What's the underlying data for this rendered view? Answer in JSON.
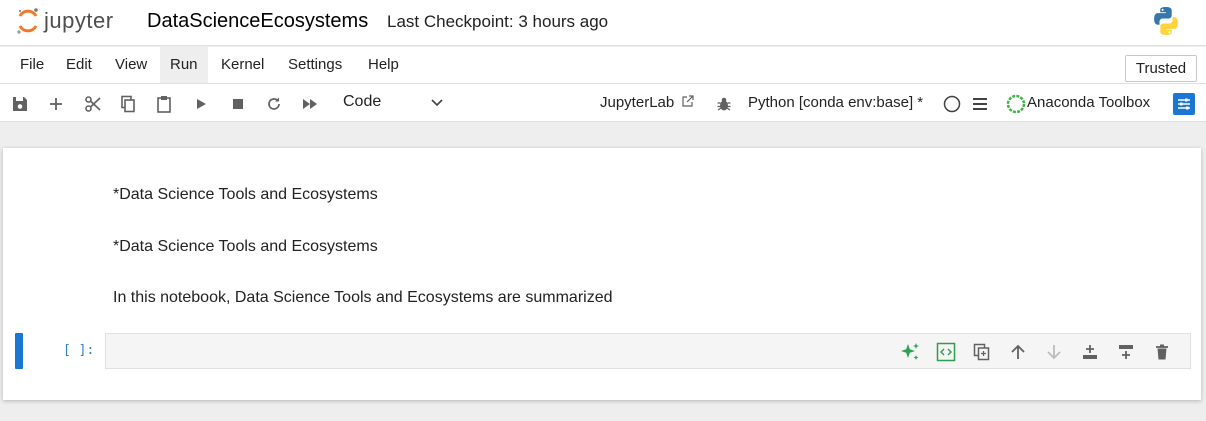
{
  "header": {
    "logo_text": "jupyter",
    "notebook_title": "DataScienceEcosystems",
    "checkpoint": "Last Checkpoint: 3 hours ago"
  },
  "menu": {
    "items": [
      "File",
      "Edit",
      "View",
      "Run",
      "Kernel",
      "Settings",
      "Help"
    ],
    "active": "Run",
    "trusted": "Trusted"
  },
  "toolbar": {
    "cell_type": "Code",
    "jupyterlab": "JupyterLab",
    "kernel": "Python [conda env:base] *",
    "anaconda": "Anaconda Toolbox"
  },
  "notebook": {
    "markdown_lines": [
      "*Data Science Tools and Ecosystems",
      "*Data Science Tools and Ecosystems",
      "In this notebook, Data Science Tools and Ecosystems are summarized"
    ],
    "prompt": "[ ]:"
  },
  "colors": {
    "accent": "#1976d2",
    "ai_green": "#2e9e4f",
    "prompt_blue": "#307fc1",
    "jupyter_orange": "#f37726"
  }
}
